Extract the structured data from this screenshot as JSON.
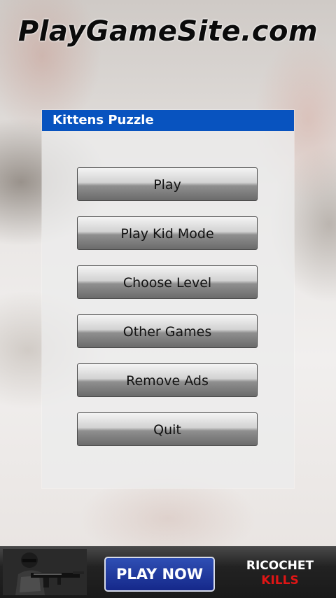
{
  "site": {
    "logo_text": "PlayGameSite.com"
  },
  "dialog": {
    "title": "Kittens Puzzle",
    "title_bar_color": "#0853bf",
    "buttons": [
      {
        "label": "Play"
      },
      {
        "label": "Play Kid Mode"
      },
      {
        "label": "Choose Level"
      },
      {
        "label": "Other Games"
      },
      {
        "label": "Remove Ads"
      },
      {
        "label": "Quit"
      }
    ]
  },
  "ad_banner": {
    "cta_label": "PLAY NOW",
    "brand_line_1": "RICOCHET",
    "brand_line_2": "KILLS",
    "cta_color": "#15288a",
    "brand_accent_color": "#e01515",
    "image_icon": "soldier-with-rifle"
  }
}
